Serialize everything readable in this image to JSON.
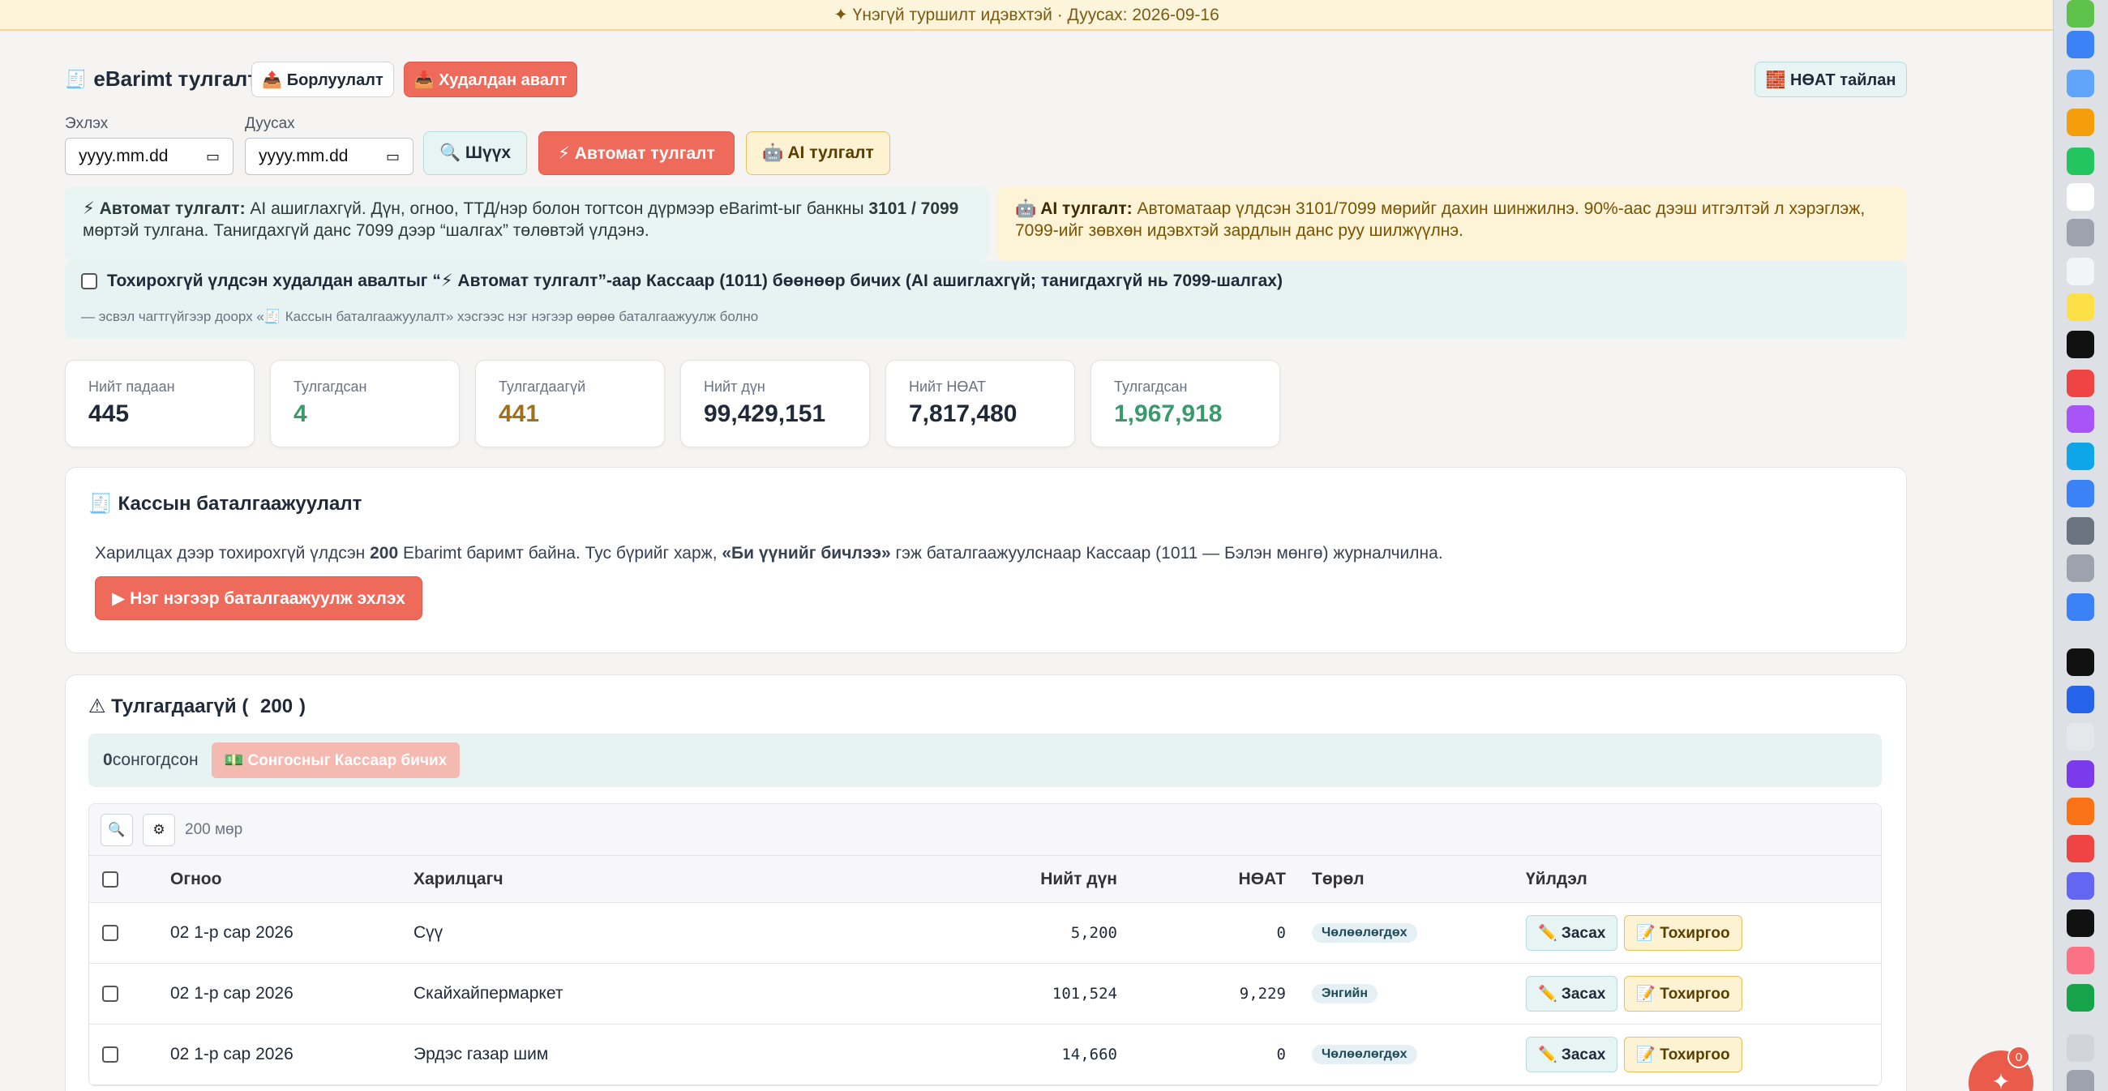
{
  "banner": "✦ Үнэгүй туршилт идэвхтэй · Дуусах: 2026-09-16",
  "header": {
    "title": "eBarimt тулгалт",
    "tab_sales": "📤 Борлуулалт",
    "tab_purchase": "📥 Худалдан авалт",
    "vat_report": "🧱 НӨАТ тайлан"
  },
  "filters": {
    "start_label": "Эхлэх",
    "end_label": "Дуусах",
    "start_value": "yyyy.mm.dd",
    "end_value": "yyyy.mm.dd",
    "search": "🔍 Шүүх",
    "auto_reconcile": "⚡ Автомат тулгалт",
    "ai_reconcile": "🤖 AI тулгалт"
  },
  "info": {
    "auto_title": "⚡ Автомат тулгалт:",
    "auto_text_1": " AI ашиглахгүй. Дүн, огноо, ТТД/нэр болон тогтсон дүрмээр eBarimt-ыг банкны ",
    "auto_bold": "3101 / 7099",
    "auto_text_2": " мөртэй тулгана. Танигдахгүй данс 7099 дээр “шалгах” төлөвтэй үлдэнэ.",
    "ai_title": "🤖 AI тулгалт:",
    "ai_text": " Автоматаар үлдсэн 3101/7099 мөрийг дахин шинжилнэ. 90%-аас дээш итгэлтэй л хэрэглэж, 7099-ийг зөвхөн идэвхтэй зардлын данс руу шилжүүлнэ."
  },
  "write_option": {
    "label": "Тохирохгүй үлдсэн худалдан авалтыг “⚡ Автомат тулгалт”-аар Кассаар (1011) бөөнөөр бичих (AI ашиглахгүй; танигдахгүй нь 7099-шалгах)",
    "hint": "— эсвэл чагтгүйгээр доорх «🧾 Кассын баталгаажуулалт» хэсгээс нэг нэгээр өөрөө баталгаажуулж болно",
    "checked": false
  },
  "stats": [
    {
      "label": "Нийт падаан",
      "value": "445",
      "color": "#1f2937"
    },
    {
      "label": "Тулгагдсан",
      "value": "4",
      "color": "#3a9a6e"
    },
    {
      "label": "Тулгагдаагүй",
      "value": "441",
      "color": "#a0701b"
    },
    {
      "label": "Нийт дүн",
      "value": "99,429,151",
      "color": "#1f2937"
    },
    {
      "label": "Нийт НӨАТ",
      "value": "7,817,480",
      "color": "#1f2937"
    },
    {
      "label": "Тулгагдсан",
      "value": "1,967,918",
      "color": "#3a9a6e"
    }
  ],
  "cash": {
    "title": "🧾 Кассын баталгаажуулалт",
    "text_1": "Харилцах дээр тохирохгүй үлдсэн ",
    "count": "200",
    "text_2": " Ebarimt баримт байна. Тус бүрийг харж, ",
    "quote": "«Би үүнийг бичлээ»",
    "text_3": " гэж баталгаажуулснаар Кассаар (1011 — Бэлэн мөнгө) журналчилна.",
    "start_button": "▶ Нэг нэгээр баталгаажуулж эхлэх"
  },
  "unmatched": {
    "title_prefix": "⚠ Тулгагдаагүй (",
    "count": "200",
    "title_suffix": ")",
    "selected_count": "0",
    "selected_label": " сонгогдсон",
    "write_selected": "💵 Сонгосныг Кассаар бичих",
    "row_count": "200 мөр",
    "columns": [
      "Огноо",
      "Харилцагч",
      "Нийт дүн",
      "НӨАТ",
      "Төрөл",
      "Үйлдэл"
    ],
    "rows": [
      {
        "date": "02 1-р сар 2026",
        "partner": "Сүү",
        "total": "5,200",
        "vat": "0",
        "type": "Чөлөөлөгдөх"
      },
      {
        "date": "02 1-р сар 2026",
        "partner": "Скайхайпермаркет",
        "total": "101,524",
        "vat": "9,229",
        "type": "Энгийн"
      },
      {
        "date": "02 1-р сар 2026",
        "partner": "Эрдэс газар шим",
        "total": "14,660",
        "vat": "0",
        "type": "Чөлөөлөгдөх"
      }
    ],
    "edit_label": "✏️ Засах",
    "match_label": "📝 Тохиргоо"
  },
  "fab_badge": "0"
}
